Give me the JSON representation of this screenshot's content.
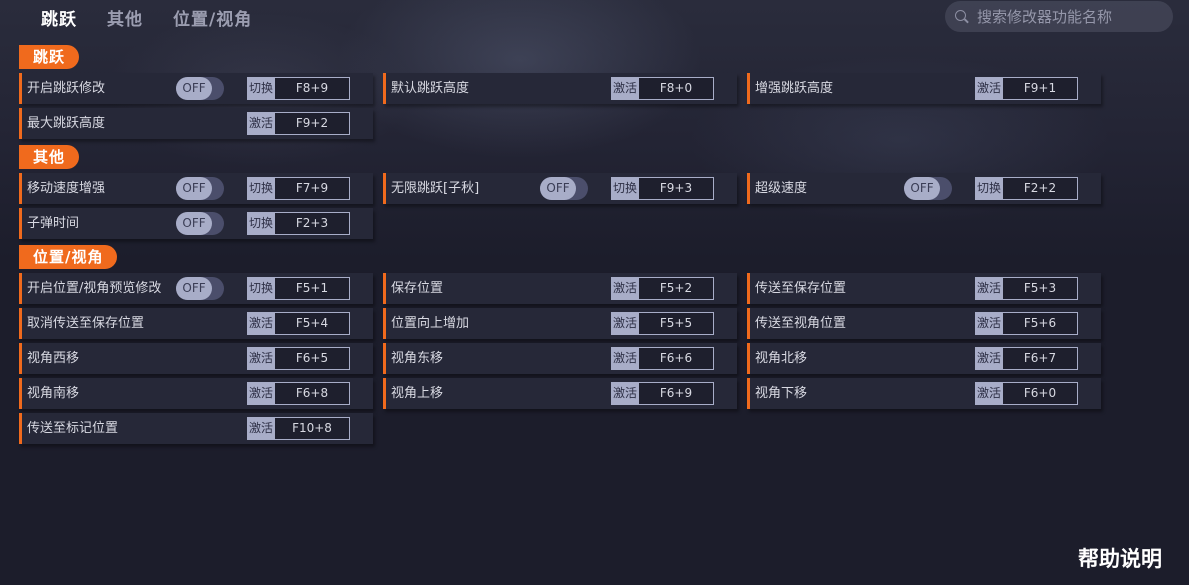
{
  "nav": {
    "tabs": [
      {
        "label": "跳跃",
        "active": true
      },
      {
        "label": "其他",
        "active": false
      },
      {
        "label": "位置/视角",
        "active": false
      }
    ]
  },
  "search": {
    "placeholder": "搜索修改器功能名称",
    "value": "",
    "icon": "search-icon"
  },
  "sections": [
    {
      "title": "跳跃",
      "items": [
        {
          "label": "开启跳跃修改",
          "toggle": "OFF",
          "action": "切换",
          "hotkey": "F8+9"
        },
        {
          "label": "默认跳跃高度",
          "action": "激活",
          "hotkey": "F8+0"
        },
        {
          "label": "增强跳跃高度",
          "action": "激活",
          "hotkey": "F9+1"
        },
        {
          "label": "最大跳跃高度",
          "action": "激活",
          "hotkey": "F9+2"
        }
      ]
    },
    {
      "title": "其他",
      "items": [
        {
          "label": "移动速度增强",
          "toggle": "OFF",
          "action": "切换",
          "hotkey": "F7+9"
        },
        {
          "label": "无限跳跃[子秋]",
          "toggle": "OFF",
          "action": "切换",
          "hotkey": "F9+3"
        },
        {
          "label": "超级速度",
          "toggle": "OFF",
          "action": "切换",
          "hotkey": "F2+2"
        },
        {
          "label": "子弹时间",
          "toggle": "OFF",
          "action": "切换",
          "hotkey": "F2+3"
        }
      ]
    },
    {
      "title": "位置/视角",
      "items": [
        {
          "label": "开启位置/视角预览修改",
          "toggle": "OFF",
          "action": "切换",
          "hotkey": "F5+1"
        },
        {
          "label": "保存位置",
          "action": "激活",
          "hotkey": "F5+2"
        },
        {
          "label": "传送至保存位置",
          "action": "激活",
          "hotkey": "F5+3"
        },
        {
          "label": "取消传送至保存位置",
          "action": "激活",
          "hotkey": "F5+4"
        },
        {
          "label": "位置向上增加",
          "action": "激活",
          "hotkey": "F5+5"
        },
        {
          "label": "传送至视角位置",
          "action": "激活",
          "hotkey": "F5+6"
        },
        {
          "label": "视角西移",
          "action": "激活",
          "hotkey": "F6+5"
        },
        {
          "label": "视角东移",
          "action": "激活",
          "hotkey": "F6+6"
        },
        {
          "label": "视角北移",
          "action": "激活",
          "hotkey": "F6+7"
        },
        {
          "label": "视角南移",
          "action": "激活",
          "hotkey": "F6+8"
        },
        {
          "label": "视角上移",
          "action": "激活",
          "hotkey": "F6+9"
        },
        {
          "label": "视角下移",
          "action": "激活",
          "hotkey": "F6+0"
        },
        {
          "label": "传送至标记位置",
          "action": "激活",
          "hotkey": "F10+8"
        }
      ]
    }
  ],
  "help": {
    "label": "帮助说明"
  },
  "colors": {
    "accent": "#f06a1d",
    "background": "#1c1d2b",
    "row": "#262838",
    "key": "#a8adc8"
  }
}
